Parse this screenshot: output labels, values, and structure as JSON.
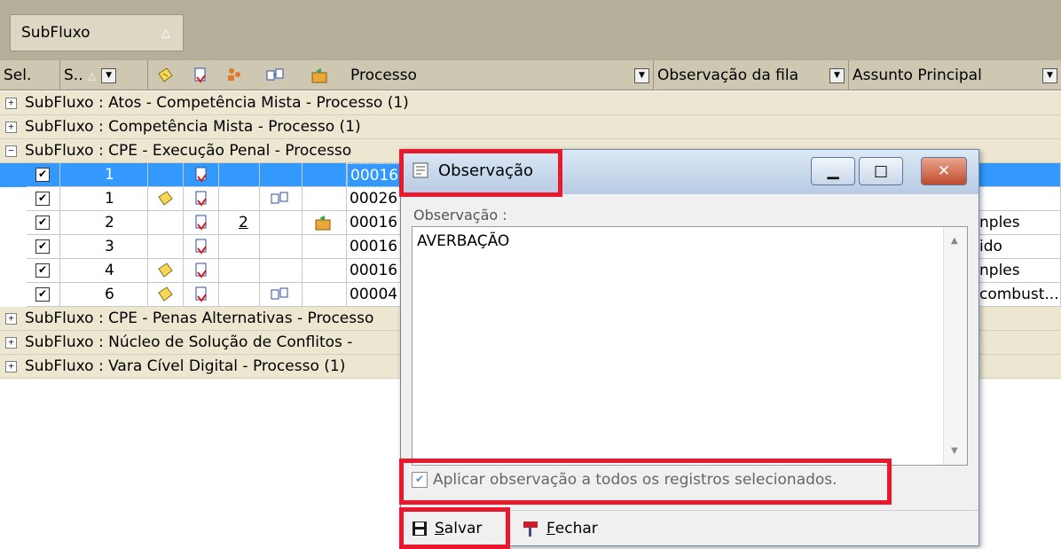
{
  "group_panel": {
    "chip_label": "SubFluxo",
    "sort_glyph": "△"
  },
  "grid": {
    "headers": {
      "sel": "Sel.",
      "seq": "S..",
      "seq_sort_glyph": "△",
      "processo": "Processo",
      "observacao": "Observação da fila",
      "assunto": "Assunto Principal",
      "dropdown_glyph": "▼"
    },
    "groups": [
      {
        "label": "SubFluxo : Atos - Competência Mista - Processo  (1)",
        "expander": "+"
      },
      {
        "label": "SubFluxo : Competência Mista - Processo  (1)",
        "expander": "+"
      },
      {
        "label": "SubFluxo : CPE - Execução Penal - Processo",
        "expander": "−"
      },
      {
        "label": "SubFluxo : CPE - Penas Alternativas - Processo",
        "expander": "+"
      },
      {
        "label": "SubFluxo : Núcleo de Solução de Conflitos -",
        "expander": "+"
      },
      {
        "label": "SubFluxo : Vara Cível Digital - Processo  (1)",
        "expander": "+"
      }
    ],
    "rows": [
      {
        "checked": "✔",
        "seq": "1",
        "count": "",
        "processo": "00016",
        "assunto": ""
      },
      {
        "checked": "✔",
        "seq": "1",
        "count": "",
        "processo": "00026",
        "assunto": ""
      },
      {
        "checked": "✔",
        "seq": "2",
        "count": "2",
        "processo": "00016",
        "assunto": "nples"
      },
      {
        "checked": "✔",
        "seq": "3",
        "count": "",
        "processo": "00016",
        "assunto": "ido"
      },
      {
        "checked": "✔",
        "seq": "4",
        "count": "",
        "processo": "00016",
        "assunto": "nples"
      },
      {
        "checked": "✔",
        "seq": "6",
        "count": "",
        "processo": "00004",
        "assunto": "combust..."
      }
    ]
  },
  "dialog": {
    "title": "Observação",
    "min_glyph": "▁",
    "max_glyph": "□",
    "close_glyph": "✕",
    "field_label": "Observação :",
    "field_value": "AVERBAÇÃO",
    "scroll_up": "▲",
    "scroll_down": "▼",
    "apply_check": "✔",
    "apply_label": "Aplicar observação a todos os registros selecionados.",
    "save_label_first": "S",
    "save_label_rest": "alvar",
    "close_label_first": "F",
    "close_label_rest": "echar"
  },
  "colors": {
    "highlight": "#e8192c",
    "selection": "#3399ff"
  }
}
